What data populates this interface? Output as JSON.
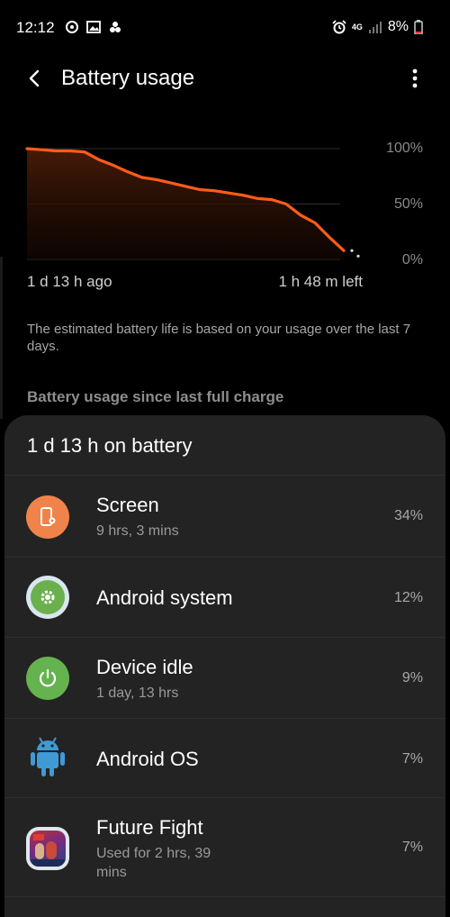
{
  "status_bar": {
    "time": "12:12",
    "battery_pct": "8%",
    "network": "4G",
    "icons_left": [
      "sync-icon",
      "gallery-icon",
      "fan-icon"
    ],
    "icons_right": [
      "alarm-icon",
      "data-icon",
      "signal-icon",
      "battery-icon"
    ]
  },
  "header": {
    "title": "Battery usage",
    "back_icon": "back-arrow-icon",
    "menu_icon": "more-vert-icon"
  },
  "chart_data": {
    "type": "line",
    "x_labels": [
      "1 d 13 h ago",
      "1 h 48 m left"
    ],
    "y_tick_labels": [
      "100%",
      "50%",
      "0%"
    ],
    "ylim": [
      0,
      100
    ],
    "series": [
      {
        "values": [
          100,
          99,
          98,
          98,
          97,
          90,
          85,
          79,
          74,
          72,
          69,
          66,
          63,
          62,
          60,
          58,
          55,
          54,
          50,
          40,
          33,
          20,
          8
        ]
      }
    ],
    "projection": [
      8,
      3
    ],
    "colors": {
      "line": "#ff5c1a",
      "fill_top": "#4a1c08",
      "grid": "#2c2c2c"
    }
  },
  "estimate_text": "The estimated battery life is based on your usage over the last 7 days.",
  "section_label": "Battery usage since last full charge",
  "card": {
    "title": "1 d 13 h on battery",
    "rows": [
      {
        "name": "Screen",
        "sub": "9 hrs, 3 mins",
        "pct": "34%",
        "icon": "screen-settings-icon",
        "color": "#f0834a"
      },
      {
        "name": "Android system",
        "sub": "",
        "pct": "12%",
        "icon": "gear-icon",
        "color": "#6ab04c"
      },
      {
        "name": "Device idle",
        "sub": "1 day, 13 hrs",
        "pct": "9%",
        "icon": "power-icon",
        "color": "#64b34e"
      },
      {
        "name": "Android OS",
        "sub": "",
        "pct": "7%",
        "icon": "android-icon",
        "color": "#3f9ad6"
      },
      {
        "name": "Future Fight",
        "sub": "Used for 2 hrs, 39 mins",
        "pct": "7%",
        "icon": "future-fight-app-icon",
        "color": "#27408a"
      }
    ]
  }
}
